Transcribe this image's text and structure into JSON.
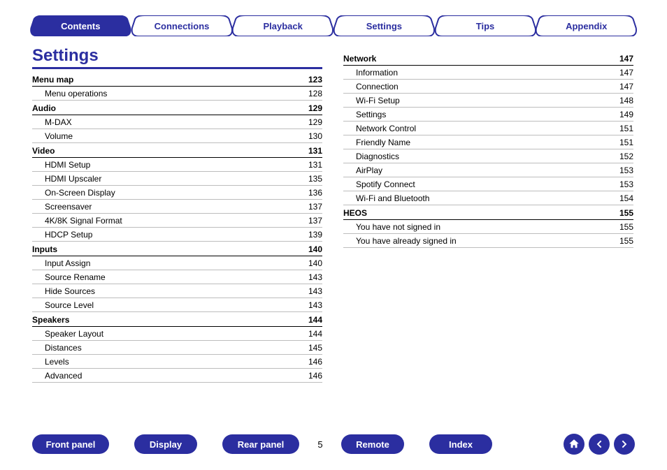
{
  "tabs": [
    {
      "label": "Contents",
      "active": true
    },
    {
      "label": "Connections",
      "active": false
    },
    {
      "label": "Playback",
      "active": false
    },
    {
      "label": "Settings",
      "active": false
    },
    {
      "label": "Tips",
      "active": false
    },
    {
      "label": "Appendix",
      "active": false
    }
  ],
  "page_title": "Settings",
  "columns": [
    [
      {
        "type": "section",
        "label": "Menu map",
        "page": "123"
      },
      {
        "type": "item",
        "label": "Menu operations",
        "page": "128"
      },
      {
        "type": "section",
        "label": "Audio",
        "page": "129"
      },
      {
        "type": "item",
        "label": "M-DAX",
        "page": "129"
      },
      {
        "type": "item",
        "label": "Volume",
        "page": "130"
      },
      {
        "type": "section",
        "label": "Video",
        "page": "131"
      },
      {
        "type": "item",
        "label": "HDMI Setup",
        "page": "131"
      },
      {
        "type": "item",
        "label": "HDMI Upscaler",
        "page": "135"
      },
      {
        "type": "item",
        "label": "On-Screen Display",
        "page": "136"
      },
      {
        "type": "item",
        "label": "Screensaver",
        "page": "137"
      },
      {
        "type": "item",
        "label": "4K/8K Signal Format",
        "page": "137"
      },
      {
        "type": "item",
        "label": "HDCP Setup",
        "page": "139"
      },
      {
        "type": "section",
        "label": "Inputs",
        "page": "140"
      },
      {
        "type": "item",
        "label": "Input Assign",
        "page": "140"
      },
      {
        "type": "item",
        "label": "Source Rename",
        "page": "143"
      },
      {
        "type": "item",
        "label": "Hide Sources",
        "page": "143"
      },
      {
        "type": "item",
        "label": "Source Level",
        "page": "143"
      },
      {
        "type": "section",
        "label": "Speakers",
        "page": "144"
      },
      {
        "type": "item",
        "label": "Speaker Layout",
        "page": "144"
      },
      {
        "type": "item",
        "label": "Distances",
        "page": "145"
      },
      {
        "type": "item",
        "label": "Levels",
        "page": "146"
      },
      {
        "type": "item",
        "label": "Advanced",
        "page": "146"
      }
    ],
    [
      {
        "type": "section",
        "label": "Network",
        "page": "147"
      },
      {
        "type": "item",
        "label": "Information",
        "page": "147"
      },
      {
        "type": "item",
        "label": "Connection",
        "page": "147"
      },
      {
        "type": "item",
        "label": "Wi-Fi Setup",
        "page": "148"
      },
      {
        "type": "item",
        "label": "Settings",
        "page": "149"
      },
      {
        "type": "item",
        "label": "Network Control",
        "page": "151"
      },
      {
        "type": "item",
        "label": "Friendly Name",
        "page": "151"
      },
      {
        "type": "item",
        "label": "Diagnostics",
        "page": "152"
      },
      {
        "type": "item",
        "label": "AirPlay",
        "page": "153"
      },
      {
        "type": "item",
        "label": "Spotify Connect",
        "page": "153"
      },
      {
        "type": "item",
        "label": "Wi-Fi and Bluetooth",
        "page": "154"
      },
      {
        "type": "section",
        "label": "HEOS",
        "page": "155"
      },
      {
        "type": "item",
        "label": "You have not signed in",
        "page": "155"
      },
      {
        "type": "item",
        "label": "You have already signed in",
        "page": "155"
      }
    ]
  ],
  "bottom": {
    "buttons_left": [
      "Front panel",
      "Display",
      "Rear panel"
    ],
    "page_number": "5",
    "buttons_right": [
      "Remote",
      "Index"
    ]
  },
  "colors": {
    "brand": "#2b2ea0"
  }
}
